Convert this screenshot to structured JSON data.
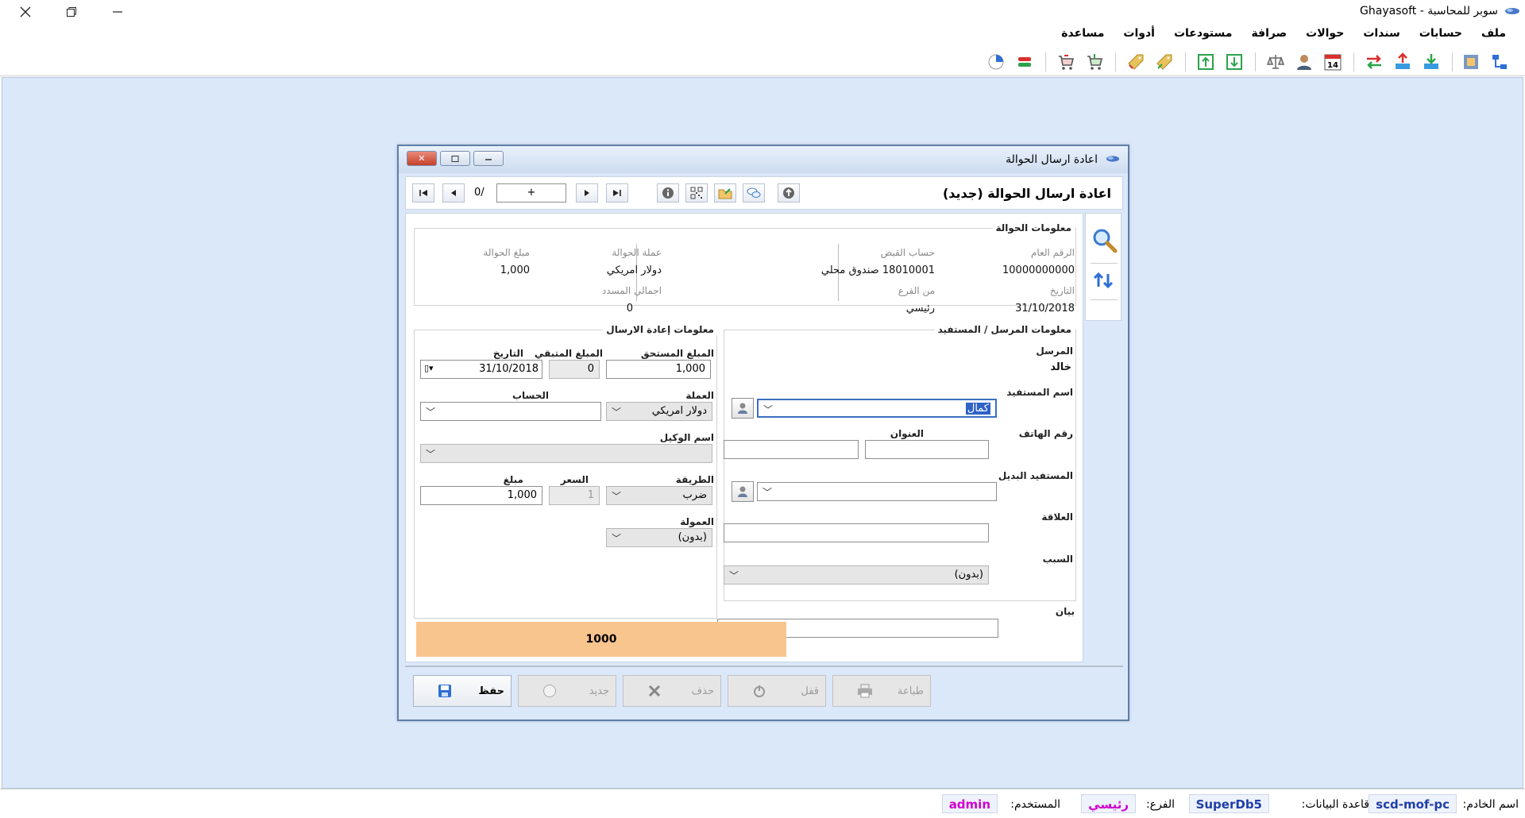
{
  "app": {
    "title": "سوبر للمحاسبة - Ghayasoft"
  },
  "menu": [
    "ملف",
    "حسابات",
    "سندات",
    "حوالات",
    "صرافة",
    "مستودعات",
    "أدوات",
    "مساعدة"
  ],
  "toolbar": {
    "icons": [
      "tree-icon",
      "card-icon",
      "download-icon",
      "upload-icon",
      "transfer-icon",
      "calendar-icon",
      "user-icon",
      "scale-icon",
      "arrow-down-icon",
      "arrow-up-icon",
      "tag-icon",
      "tag2-icon",
      "cart-icon",
      "cart2-icon",
      "exchange-icon",
      "pie-icon"
    ],
    "calendar_day": "14"
  },
  "dialog": {
    "title": "اعادة ارسال الحوالة",
    "heading": "اعادة ارسال الحوالة (جديد)",
    "nav": {
      "record_input": "+",
      "counter": "0/"
    },
    "transfer_info": {
      "title": "معلومات الحوالة",
      "general_no_label": "الرقم العام",
      "general_no": "10000000000",
      "receipt_account_label": "حساب القبض",
      "receipt_account": "18010001 صندوق محلي",
      "currency_label": "عملة الحوالة",
      "currency": "دولار امريكي",
      "amount_label": "مبلغ الحوالة",
      "amount": "1,000",
      "date_label": "التاريخ",
      "date": "31/10/2018",
      "branch_label": "من الفرع",
      "branch": "رئيسي",
      "total_paid_label": "اجمالي المسدد",
      "total_paid": "0"
    },
    "sender_info": {
      "title": "معلومات المرسل / المستفيد",
      "sender_label": "المرسل",
      "sender": "خالد",
      "beneficiary_label": "اسم المستفيد",
      "beneficiary": "كمال",
      "phone_label": "رقم الهاتف",
      "phone": "",
      "address_label": "العنوان",
      "address": "",
      "alt_beneficiary_label": "المستفيد البديل",
      "alt_beneficiary": "",
      "relation_label": "العلاقة",
      "relation": "",
      "reason_label": "السبب",
      "reason": "(بدون)"
    },
    "resend_info": {
      "title": "معلومات إعادة الارسال",
      "due_label": "المبلغ المستحق",
      "due": "1,000",
      "remaining_label": "المبلغ المتبقي",
      "remaining": "0",
      "date_label": "التاريخ",
      "date": "31/10/2018",
      "currency_label": "العملة",
      "currency": "دولار امريكي",
      "account_label": "الحساب",
      "account": "",
      "agent_label": "اسم الوكيل",
      "agent": "",
      "method_label": "الطريقة",
      "method": "ضرب",
      "rate_label": "السعر",
      "rate": "1",
      "amount_label": "مبلغ",
      "amount": "1,000",
      "commission_label": "العمولة",
      "commission": "(بدون)"
    },
    "statement_label": "بيان",
    "statement": "",
    "total": "1000",
    "buttons": {
      "save": "حفظ",
      "new": "جديد",
      "delete": "حذف",
      "lock": "قفل",
      "print": "طباعة"
    }
  },
  "status": {
    "server_label": "اسم الخادم:",
    "server": "scd-mof-pc",
    "db_label": "قاعدة البيانات:",
    "db": "SuperDb5",
    "branch_label": "الفرع:",
    "branch": "رئيسي",
    "user_label": "المستخدم:",
    "user": "admin"
  },
  "colors": {
    "accent": "#1f3fa8",
    "highlight": "#d000d0",
    "total_bg": "#f9c58e",
    "desktop": "#dbe8fa"
  }
}
